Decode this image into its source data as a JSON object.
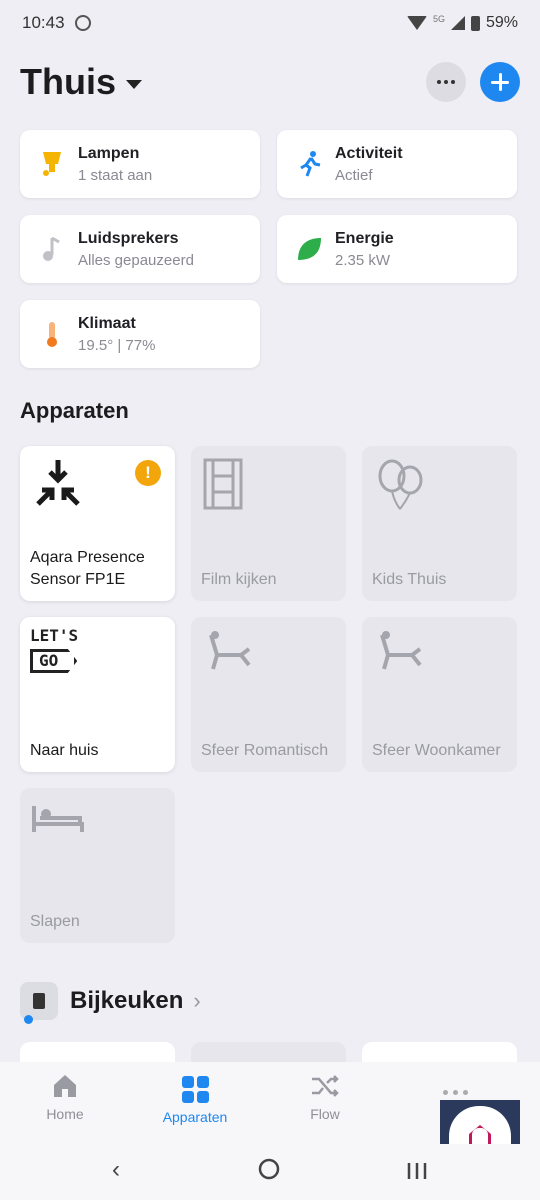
{
  "status": {
    "time": "10:43",
    "battery": "59%",
    "network_badge": "5G"
  },
  "header": {
    "title": "Thuis"
  },
  "summary": [
    {
      "title": "Lampen",
      "subtitle": "1 staat aan",
      "icon": "lamp-icon",
      "color": "#f4b400"
    },
    {
      "title": "Activiteit",
      "subtitle": "Actief",
      "icon": "motion-icon",
      "color": "#1e87f0"
    },
    {
      "title": "Luidsprekers",
      "subtitle": "Alles gepauzeerd",
      "icon": "music-note-icon",
      "color": "#b9b9c0"
    },
    {
      "title": "Energie",
      "subtitle": "2.35 kW",
      "icon": "leaf-icon",
      "color": "#2eae4a"
    },
    {
      "title": "Klimaat",
      "subtitle": "19.5° | 77%",
      "icon": "thermometer-icon",
      "color": "#f07a1e"
    }
  ],
  "sections": {
    "apparaten": "Apparaten"
  },
  "devices": [
    {
      "name": "Aqara Presence Sensor FP1E",
      "state": "on",
      "warning": "!"
    },
    {
      "name": "Film kijken",
      "state": "off"
    },
    {
      "name": "Kids Thuis",
      "state": "off"
    },
    {
      "name": "Naar huis",
      "state": "on",
      "logo_lines": [
        "LET'S",
        "GO"
      ]
    },
    {
      "name": "Sfeer Romantisch",
      "state": "off"
    },
    {
      "name": "Sfeer Woonkamer",
      "state": "off"
    },
    {
      "name": "Slapen",
      "state": "off"
    }
  ],
  "room": {
    "title": "Bijkeuken"
  },
  "nav": {
    "home": "Home",
    "devices": "Apparaten",
    "flow": "Flow"
  }
}
